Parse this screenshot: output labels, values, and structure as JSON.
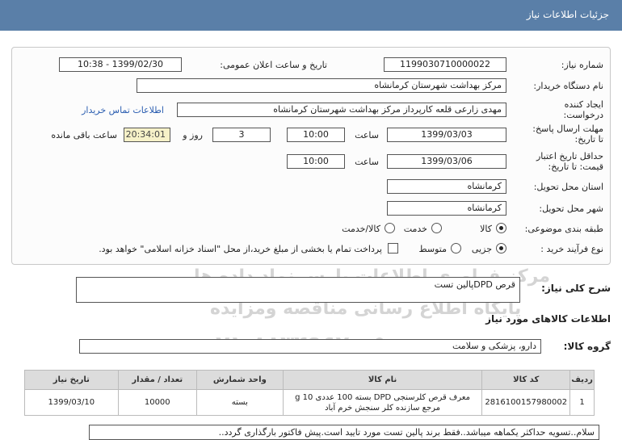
{
  "title": "جزئیات اطلاعات نیاز",
  "watermark": {
    "line1": "مرکز فراوری اطلاعات پارس نماد داده ها",
    "line2": "پایگاه اطلاع رسانی مناقصه ومزایده",
    "line3": "۰۲۱-۸۸۳۴۹۶۷۰-۵"
  },
  "form": {
    "need_number_label": "شماره نیاز:",
    "need_number": "1199030710000022",
    "announce_label": "تاریخ و ساعت اعلان عمومی:",
    "announce_value": "1399/02/30 - 10:38",
    "buyer_label": "نام دستگاه خریدار:",
    "buyer_value": "مرکز بهداشت شهرستان کرمانشاه",
    "creator_label_1": "ایجاد کننده",
    "creator_label_2": "درخواست:",
    "creator_value": "مهدی  زارعی قلعه کارپرداز مرکز بهداشت شهرستان کرمانشاه",
    "contact_link": "اطلاعات تماس خریدار",
    "deadline_label_1": "مهلت ارسال پاسخ:",
    "deadline_label_2": "تا تاریخ:",
    "deadline_date": "1399/03/03",
    "time_label": "ساعت",
    "deadline_time": "10:00",
    "days_value": "3",
    "days_label": "روز و",
    "remaining_time": "20:34:01",
    "remaining_label": "ساعت باقی مانده",
    "validity_label_1": "حداقل تاریخ اعتبار",
    "validity_label_2": "قیمت: تا تاریخ:",
    "validity_date": "1399/03/06",
    "validity_time": "10:00",
    "province_label": "استان محل تحویل:",
    "province_value": "کرمانشاه",
    "city_label": "شهر محل تحویل:",
    "city_value": "کرمانشاه",
    "category_label": "طبقه بندی موضوعی:",
    "category_options": [
      "کالا",
      "خدمت",
      "کالا/خدمت"
    ],
    "category_selected": "کالا",
    "process_label": "نوع فرآیند خرید :",
    "process_options": [
      "جزیی",
      "متوسط"
    ],
    "process_selected": "جزیی",
    "payment_note": "پرداخت تمام یا بخشی از مبلغ خرید،از محل \"اسناد خزانه اسلامی\" خواهد بود."
  },
  "summary": {
    "label": "شرح کلی نیاز:",
    "value": "قرص DPDپالین تست"
  },
  "items_section": {
    "label": "اطلاعات کالاهای مورد نیاز",
    "group_label": "گروه کالا:",
    "group_value": "دارو، پزشکی و سلامت",
    "columns": [
      "ردیف",
      "کد کالا",
      "نام کالا",
      "واحد شمارش",
      "تعداد / مقدار",
      "تاریخ نیاز"
    ],
    "rows": [
      {
        "row": "1",
        "code": "2816100157980002",
        "name": "معرف قرص کلرسنجی DPD بسته 100 عددی 10 g مرجع سازنده کلر سنجش خرم آباد",
        "unit": "بسته",
        "qty": "10000",
        "date": "1399/03/10"
      }
    ]
  },
  "description": "سلام..تسویه حداکثر یکماهه میباشد..فقط برند پالین تست مورد تایید است.پیش فاکتور بارگذاری گردد.."
}
